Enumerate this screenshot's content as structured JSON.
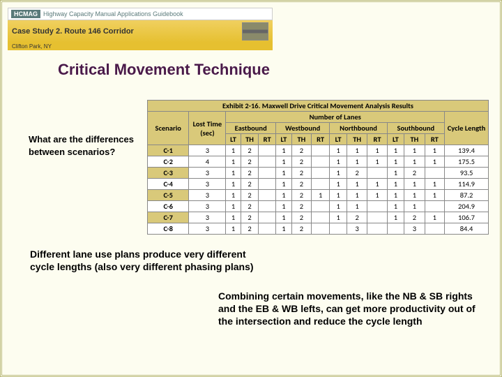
{
  "banner": {
    "badge": "HCMAG",
    "top": "Highway Capacity Manual Applications Guidebook",
    "mid": "Case Study 2. Route 146 Corridor",
    "bot": "Clifton Park, NY"
  },
  "title": "Critical Movement Technique",
  "side_question": "What are the differences between scenarios?",
  "table": {
    "caption": "Exhibit 2-16. Maxwell Drive Critical Movement Analysis Results",
    "group_header": "Number of Lanes",
    "col_scenario": "Scenario",
    "col_lost": "Lost Time (sec)",
    "dirs": [
      "Eastbound",
      "Westbound",
      "Northbound",
      "Southbound"
    ],
    "sub": [
      "LT",
      "TH",
      "RT",
      "LT",
      "TH",
      "RT",
      "LT",
      "TH",
      "RT",
      "LT",
      "TH",
      "RT"
    ],
    "col_cycle": "Cycle Length",
    "rows": [
      {
        "s": "C-1",
        "lt": "3",
        "v": [
          "1",
          "2",
          "",
          "1",
          "2",
          "",
          "1",
          "1",
          "1",
          "1",
          "1",
          "1"
        ],
        "cl": "139.4"
      },
      {
        "s": "C-2",
        "lt": "4",
        "v": [
          "1",
          "2",
          "",
          "1",
          "2",
          "",
          "1",
          "1",
          "1",
          "1",
          "1",
          "1"
        ],
        "cl": "175.5"
      },
      {
        "s": "C-3",
        "lt": "3",
        "v": [
          "1",
          "2",
          "",
          "1",
          "2",
          "",
          "1",
          "2",
          "",
          "1",
          "2",
          ""
        ],
        "cl": "93.5"
      },
      {
        "s": "C-4",
        "lt": "3",
        "v": [
          "1",
          "2",
          "",
          "1",
          "2",
          "",
          "1",
          "1",
          "1",
          "1",
          "1",
          "1"
        ],
        "cl": "114.9"
      },
      {
        "s": "C-5",
        "lt": "3",
        "v": [
          "1",
          "2",
          "",
          "1",
          "2",
          "1",
          "1",
          "1",
          "1",
          "1",
          "1",
          "1"
        ],
        "cl": "87.2"
      },
      {
        "s": "C-6",
        "lt": "3",
        "v": [
          "1",
          "2",
          "",
          "1",
          "2",
          "",
          "1",
          "1",
          "",
          "1",
          "1",
          ""
        ],
        "cl": "204.9"
      },
      {
        "s": "C-7",
        "lt": "3",
        "v": [
          "1",
          "2",
          "",
          "1",
          "2",
          "",
          "1",
          "2",
          "",
          "1",
          "2",
          "1"
        ],
        "cl": "106.7"
      },
      {
        "s": "C-8",
        "lt": "3",
        "v": [
          "1",
          "2",
          "",
          "1",
          "2",
          "",
          "",
          "3",
          "",
          "",
          "3",
          ""
        ],
        "cl": "84.4"
      }
    ]
  },
  "bottom1": "Different lane use plans produce very different cycle lengths (also very different phasing plans)",
  "bottom2": "Combining certain movements, like the NB & SB rights and the EB & WB lefts, can get more productivity out of the intersection and reduce the cycle length"
}
